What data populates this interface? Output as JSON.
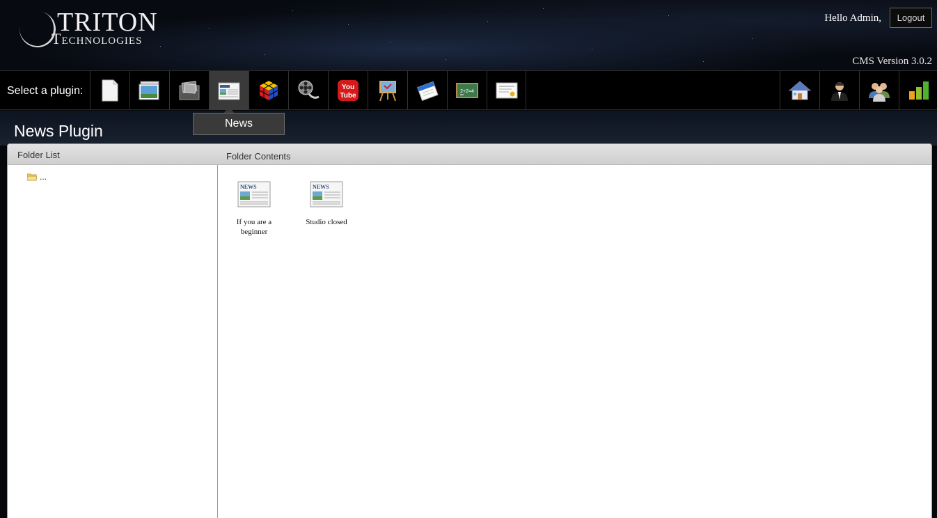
{
  "header": {
    "logo_line1": "TRITON",
    "logo_line2": "Technologies",
    "greeting": "Hello Admin,",
    "logout_label": "Logout",
    "version": "CMS Version 3.0.2"
  },
  "toolbar": {
    "select_label": "Select a plugin:",
    "plugins": [
      {
        "icon": "page-icon"
      },
      {
        "icon": "gallery-icon"
      },
      {
        "icon": "photo-album-icon"
      },
      {
        "icon": "news-icon",
        "active": true
      },
      {
        "icon": "cube-icon"
      },
      {
        "icon": "film-reel-icon"
      },
      {
        "icon": "youtube-icon"
      },
      {
        "icon": "presentation-icon"
      },
      {
        "icon": "calendar-icon"
      },
      {
        "icon": "chalkboard-icon"
      },
      {
        "icon": "certificate-icon"
      }
    ],
    "right_tools": [
      {
        "icon": "home-icon"
      },
      {
        "icon": "user-icon"
      },
      {
        "icon": "users-icon"
      },
      {
        "icon": "stats-icon"
      }
    ],
    "tooltip": "News"
  },
  "page": {
    "title": "News Plugin"
  },
  "folder_list": {
    "title": "Folder List",
    "items": [
      {
        "label": "..."
      }
    ]
  },
  "folder_contents": {
    "title": "Folder Contents",
    "items": [
      {
        "label": "If you are a beginner"
      },
      {
        "label": "Studio closed"
      }
    ]
  },
  "colors": {
    "background": "#05070b",
    "toolbar_active": "#3a3a3a",
    "panel_header": "#d8d8d8"
  }
}
